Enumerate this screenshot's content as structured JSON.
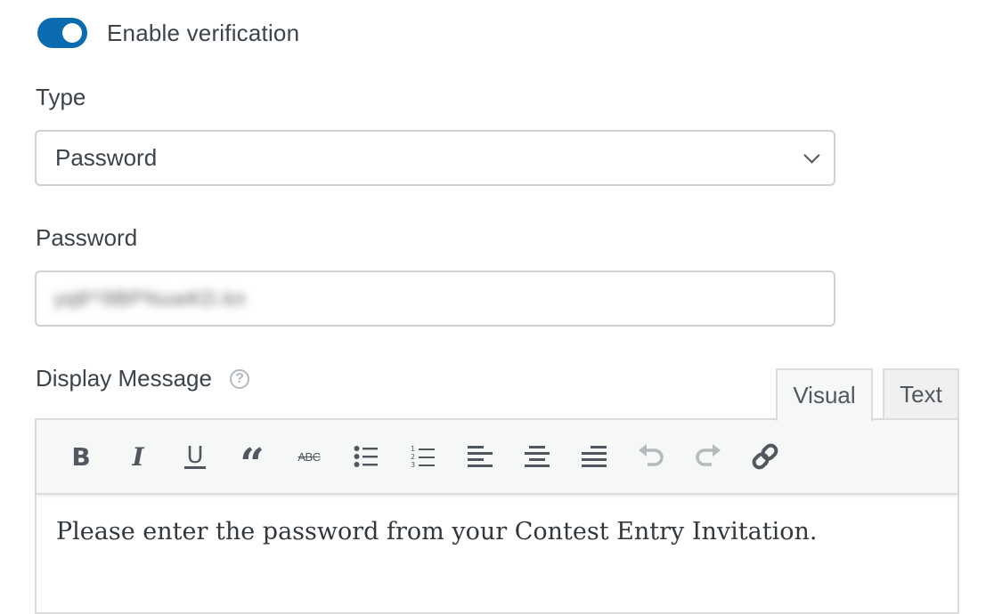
{
  "verification": {
    "label": "Enable verification",
    "enabled": true,
    "accent_color": "#0b6bb0"
  },
  "type_field": {
    "label": "Type",
    "selected": "Password"
  },
  "password_field": {
    "label": "Password",
    "value_masked": "yq8*!9BP%uwKD.kn"
  },
  "display_message": {
    "label": "Display Message",
    "help_icon": "?",
    "tabs": [
      {
        "label": "Visual",
        "active": true
      },
      {
        "label": "Text",
        "active": false
      }
    ],
    "toolbar": [
      {
        "icon": "bold-icon",
        "glyph": "B"
      },
      {
        "icon": "italic-icon",
        "glyph": "I"
      },
      {
        "icon": "underline-icon",
        "glyph": "U"
      },
      {
        "icon": "blockquote-icon",
        "glyph": "“"
      },
      {
        "icon": "strikethrough-icon",
        "glyph": "ABC"
      },
      {
        "icon": "bulleted-list-icon"
      },
      {
        "icon": "numbered-list-icon"
      },
      {
        "icon": "align-left-icon"
      },
      {
        "icon": "align-center-icon"
      },
      {
        "icon": "align-right-icon"
      },
      {
        "icon": "undo-icon",
        "disabled": true
      },
      {
        "icon": "redo-icon",
        "disabled": true
      },
      {
        "icon": "link-icon"
      }
    ],
    "content": "Please enter the password from your Contest Entry Invitation."
  }
}
